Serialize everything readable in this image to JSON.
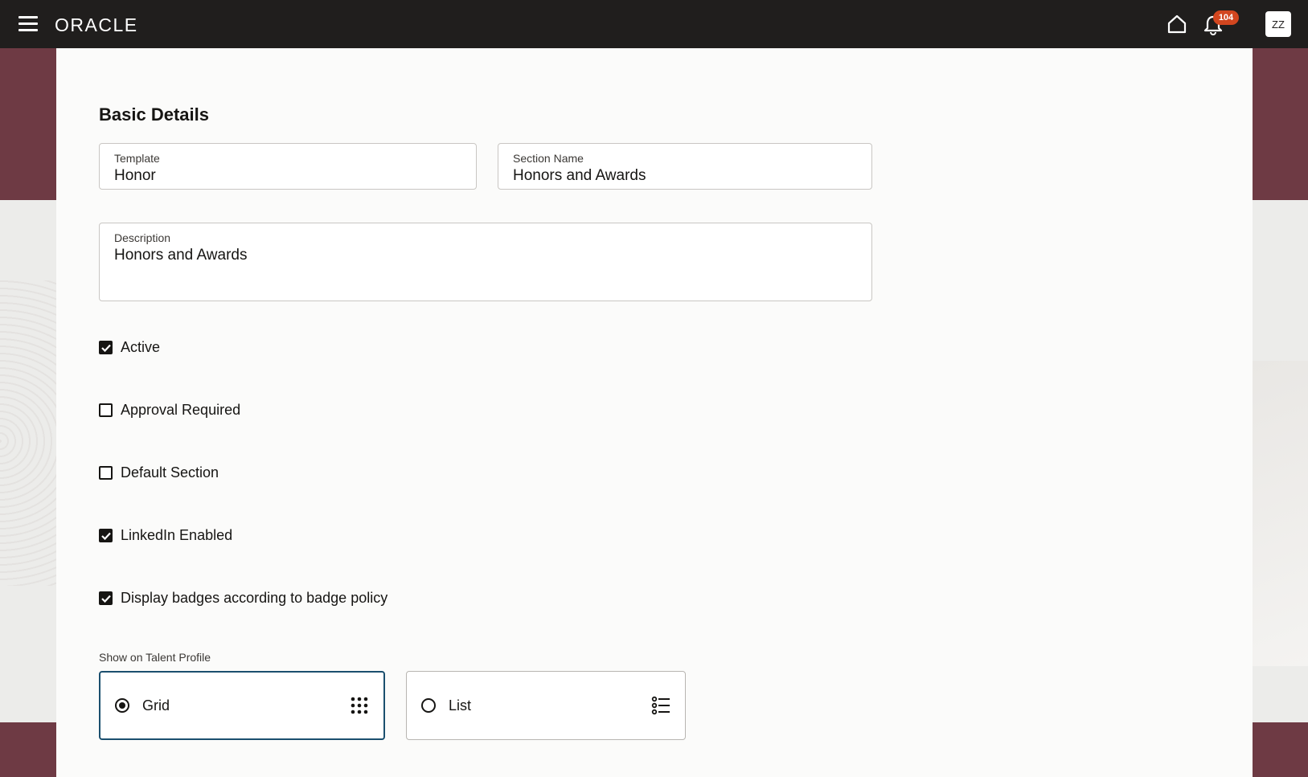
{
  "header": {
    "logo_text": "ORACLE",
    "menu_icon": "hamburger-icon",
    "home_icon": "home-icon",
    "bell_icon": "bell-icon",
    "notification_count": "104",
    "avatar_initials": "ZZ"
  },
  "form": {
    "section_title": "Basic Details",
    "template": {
      "label": "Template",
      "value": "Honor"
    },
    "section_name": {
      "label": "Section Name",
      "value": "Honors and Awards"
    },
    "description": {
      "label": "Description",
      "value": "Honors and Awards"
    },
    "checkboxes": [
      {
        "label": "Active",
        "checked": true
      },
      {
        "label": "Approval Required",
        "checked": false
      },
      {
        "label": "Default Section",
        "checked": false
      },
      {
        "label": "LinkedIn Enabled",
        "checked": true
      },
      {
        "label": "Display badges according to badge policy",
        "checked": true
      }
    ],
    "show_on_profile": {
      "label": "Show on Talent Profile",
      "options": [
        {
          "label": "Grid",
          "icon": "grid-icon",
          "selected": true
        },
        {
          "label": "List",
          "icon": "list-icon",
          "selected": false
        }
      ]
    }
  },
  "colors": {
    "topbar": "#201e1d",
    "brand_band": "#6e3a44",
    "badge": "#d2461f",
    "selected_border": "#1b4f6e"
  }
}
